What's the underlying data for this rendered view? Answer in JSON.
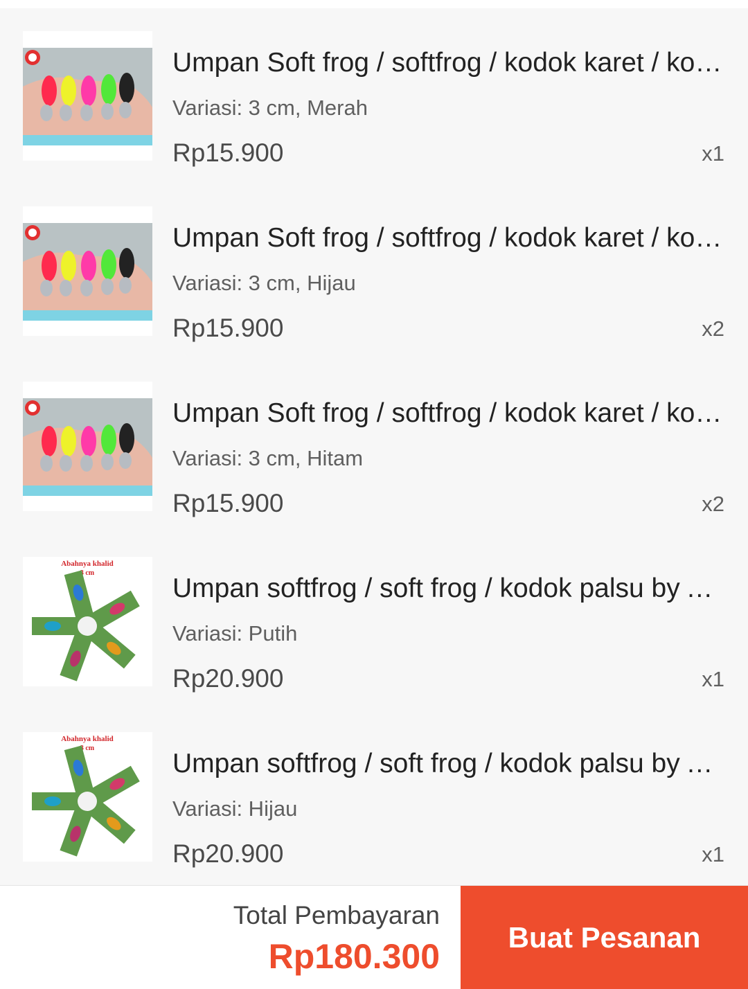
{
  "items": [
    {
      "title": "Umpan Soft frog / softfrog / kodok karet / kodok palsu",
      "variant": "Variasi: 3 cm, Merah",
      "price": "Rp15.900",
      "qty": "x1",
      "image_icon": "frog-lure-hand-photo"
    },
    {
      "title": "Umpan Soft frog / softfrog / kodok karet / kodok palsu",
      "variant": "Variasi: 3 cm, Hijau",
      "price": "Rp15.900",
      "qty": "x2",
      "image_icon": "frog-lure-hand-photo"
    },
    {
      "title": "Umpan Soft frog / softfrog / kodok karet / kodok palsu",
      "variant": "Variasi: 3 cm, Hitam",
      "price": "Rp15.900",
      "qty": "x2",
      "image_icon": "frog-lure-hand-photo"
    },
    {
      "title": "Umpan softfrog / soft frog / kodok palsu by Abahnya khalid",
      "variant": "Variasi: Putih",
      "price": "Rp20.900",
      "qty": "x1",
      "image_icon": "frog-lure-pack-photo",
      "image_caption": "Abahnya khalid",
      "image_subcaption": "3 cm"
    },
    {
      "title": "Umpan softfrog / soft frog / kodok palsu by Abahnya khalid",
      "variant": "Variasi: Hijau",
      "price": "Rp20.900",
      "qty": "x1",
      "image_icon": "frog-lure-pack-photo",
      "image_caption": "Abahnya khalid",
      "image_subcaption": "3 cm"
    }
  ],
  "footer": {
    "total_label": "Total Pembayaran",
    "total_value": "Rp180.300",
    "order_button": "Buat Pesanan"
  },
  "colors": {
    "accent": "#ee4d2d",
    "list_background": "#f7f7f7"
  }
}
